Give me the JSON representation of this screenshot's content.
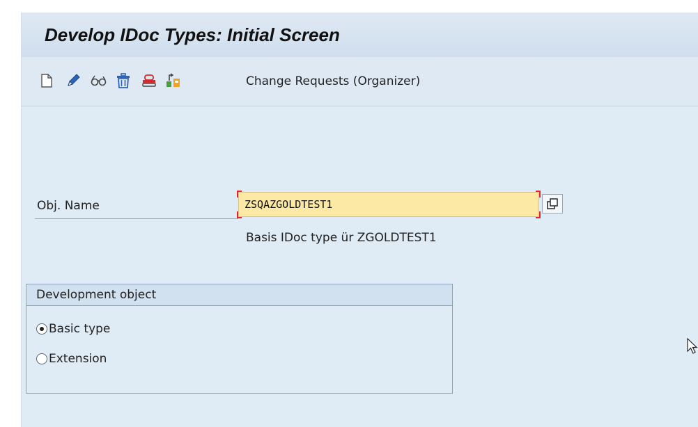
{
  "window": {
    "title": "Develop IDoc Types: Initial Screen"
  },
  "toolbar": {
    "icons": [
      "create-icon",
      "change-pencil-icon",
      "display-glasses-icon",
      "delete-trash-icon",
      "copy-icon",
      "check-icon"
    ],
    "change_requests_label": "Change Requests (Organizer)"
  },
  "form": {
    "obj_name_label": "Obj. Name",
    "obj_name_value": "ZSQAZGOLDTEST1",
    "obj_name_description": "Basis IDoc type ür ZGOLDTEST1"
  },
  "development_object": {
    "title": "Development object",
    "options": [
      {
        "label": "Basic type",
        "selected": true
      },
      {
        "label": "Extension",
        "selected": false
      }
    ]
  },
  "colors": {
    "background": "#dfebf5",
    "input_required": "#fbe9a5",
    "required_marker": "#e0262a"
  }
}
